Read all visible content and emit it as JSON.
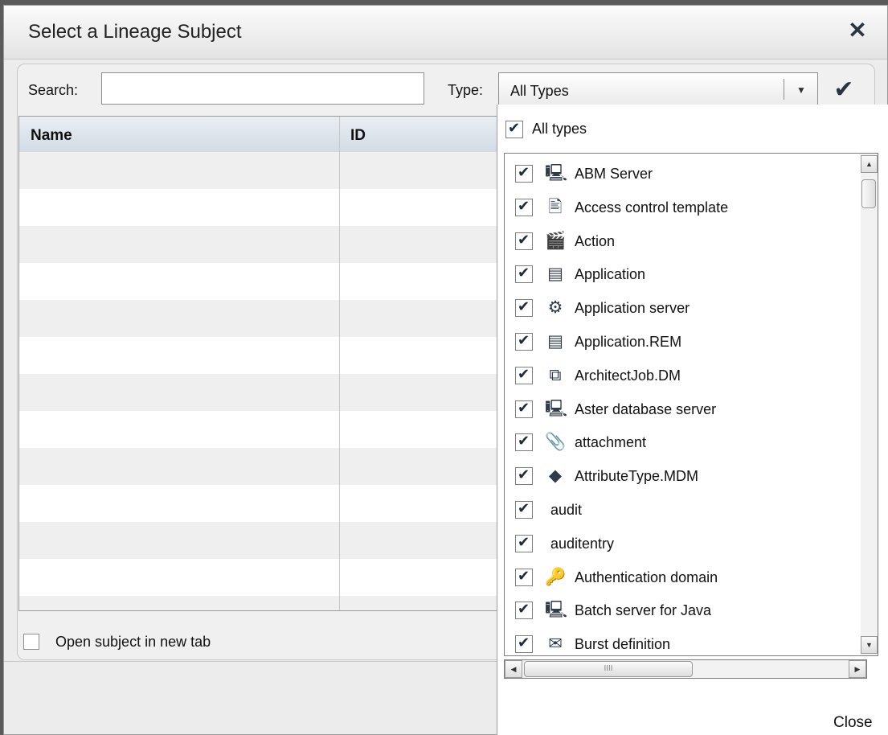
{
  "dialog": {
    "title": "Select a Lineage Subject",
    "close_symbol": "✕"
  },
  "search": {
    "label": "Search:",
    "value": "",
    "placeholder": ""
  },
  "type_filter": {
    "label": "Type:",
    "selected": "All Types",
    "arrow_symbol": "▼",
    "apply_symbol": "✔"
  },
  "table": {
    "columns": [
      "Name",
      "ID"
    ],
    "rows": 13
  },
  "open_in_new_tab": {
    "label": "Open subject in new tab",
    "checked": false
  },
  "type_popup": {
    "all_types": {
      "label": "All types",
      "checked": true
    },
    "items": [
      {
        "label": "ABM Server",
        "icon": "server-icon",
        "glyph": "🖳",
        "checked": true
      },
      {
        "label": "Access control template",
        "icon": "access-template-icon",
        "glyph": "🖹",
        "checked": true
      },
      {
        "label": "Action",
        "icon": "action-icon",
        "glyph": "🎬",
        "checked": true
      },
      {
        "label": "Application",
        "icon": "application-icon",
        "glyph": "▤",
        "checked": true
      },
      {
        "label": "Application server",
        "icon": "gears-icon",
        "glyph": "⚙",
        "checked": true
      },
      {
        "label": "Application.REM",
        "icon": "application-icon",
        "glyph": "▤",
        "checked": true
      },
      {
        "label": "ArchitectJob.DM",
        "icon": "job-flow-icon",
        "glyph": "⧉",
        "checked": true
      },
      {
        "label": "Aster database server",
        "icon": "server-icon",
        "glyph": "🖳",
        "checked": true
      },
      {
        "label": "attachment",
        "icon": "paperclip-icon",
        "glyph": "📎",
        "checked": true
      },
      {
        "label": "AttributeType.MDM",
        "icon": "attribute-type-icon",
        "glyph": "◆",
        "checked": true
      },
      {
        "label": "audit",
        "icon": "",
        "glyph": "",
        "checked": true
      },
      {
        "label": "auditentry",
        "icon": "",
        "glyph": "",
        "checked": true
      },
      {
        "label": "Authentication domain",
        "icon": "authentication-domain-icon",
        "glyph": "🔑",
        "checked": true
      },
      {
        "label": "Batch server for Java",
        "icon": "server-icon",
        "glyph": "🖳",
        "checked": true
      },
      {
        "label": "Burst definition",
        "icon": "burst-definition-icon",
        "glyph": "✉",
        "checked": true
      }
    ],
    "scroll_up": "▲",
    "scroll_down": "▼",
    "scroll_left": "◀",
    "scroll_right": "▶",
    "thumb_grip": "IIII",
    "close_label": "Close"
  }
}
